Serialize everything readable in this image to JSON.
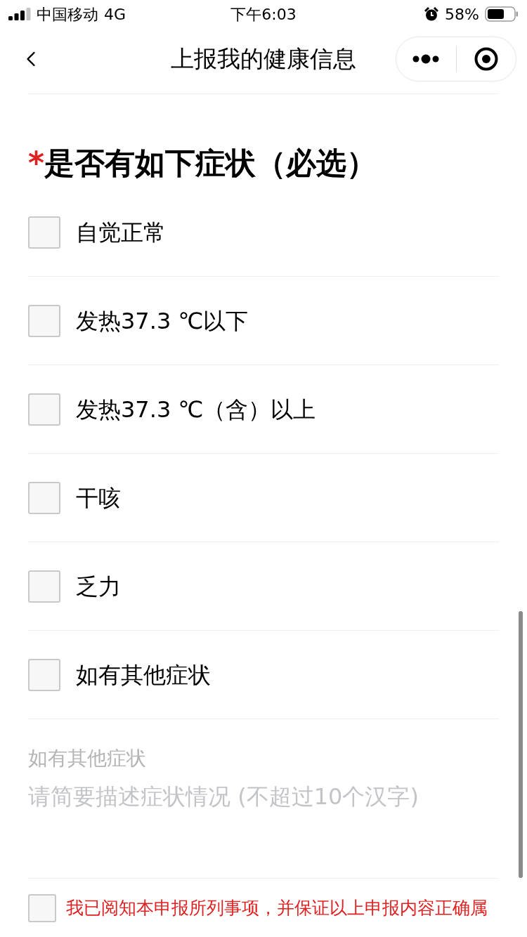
{
  "status_bar": {
    "carrier": "中国移动",
    "network": "4G",
    "time": "下午6:03",
    "battery": "58%"
  },
  "nav_bar": {
    "title": "上报我的健康信息"
  },
  "question": {
    "required_mark": "*",
    "title": "是否有如下症状（必选）",
    "options": [
      {
        "label": "自觉正常",
        "checked": false
      },
      {
        "label": "发热37.3 ℃以下",
        "checked": false
      },
      {
        "label": "发热37.3 ℃（含）以上",
        "checked": false
      },
      {
        "label": "干咳",
        "checked": false
      },
      {
        "label": "乏力",
        "checked": false
      },
      {
        "label": "如有其他症状",
        "checked": false
      }
    ]
  },
  "other_symptoms": {
    "label": "如有其他症状",
    "placeholder": "请简要描述症状情况 (不超过10个汉字)"
  },
  "agreement": {
    "text": "我已阅知本申报所列事项，并保证以上申报内容正确属",
    "checked": false
  }
}
